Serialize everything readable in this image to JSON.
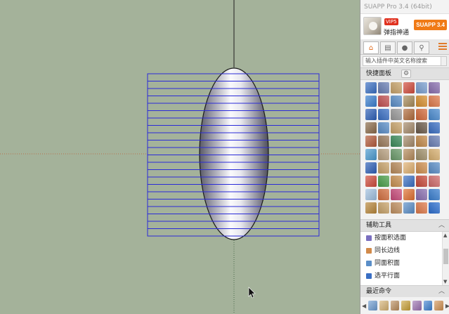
{
  "app": {
    "title": "SUAPP Pro 3.4 (64bit)",
    "brand_badge": "SUAPP 3.4"
  },
  "user": {
    "vip_badge": "VIP5",
    "name": "弹指神通"
  },
  "tabs": [
    {
      "name": "home",
      "icon": "home-icon"
    },
    {
      "name": "chart",
      "icon": "chart-icon"
    },
    {
      "name": "user",
      "icon": "user-icon"
    },
    {
      "name": "search",
      "icon": "search-icon"
    }
  ],
  "search": {
    "placeholder": "输入插件中英文名称搜索"
  },
  "quick_panel": {
    "title": "快捷面板",
    "tool_colors": [
      "#3a6fc4",
      "#6a7fb5",
      "#c8a36a",
      "#d24c3c",
      "#7a9fd0",
      "#8a6fb0",
      "#3a7fd0",
      "#c35050",
      "#5a8ec8",
      "#a78b5a",
      "#d89030",
      "#e07a4a",
      "#2d5fb8",
      "#3a6fc4",
      "#999999",
      "#b06a3a",
      "#d46a3a",
      "#4a8bd0",
      "#8a6a4a",
      "#5a8ec8",
      "#c8a36a",
      "#a58a6a",
      "#6a5a4a",
      "#3a6fc4",
      "#b45a3a",
      "#9a7a5a",
      "#3a8a5a",
      "#a58a6a",
      "#c38a4a",
      "#6a7fb5",
      "#4a9ad0",
      "#b8a080",
      "#6a9a6a",
      "#b48a5a",
      "#a0906a",
      "#d8b070",
      "#2d5fb8",
      "#c8a36a",
      "#b88a5a",
      "#e0b070",
      "#d09050",
      "#5a8ec8",
      "#d04a3a",
      "#4aa04a",
      "#c89050",
      "#3a6fc4",
      "#c84a3a",
      "#d06a6a",
      "#a0c0e0",
      "#d47040",
      "#c84a7a",
      "#e07030",
      "#8a6fb0",
      "#3a7fd0",
      "#b8863a",
      "#c8a36a",
      "#c09060",
      "#5a8ec8",
      "#e07a4a",
      "#2d6fd0"
    ]
  },
  "helper": {
    "title": "辅助工具",
    "items": [
      {
        "label": "按面积选面",
        "color": "#7a6fc0"
      },
      {
        "label": "同长边线",
        "color": "#d28a4a"
      },
      {
        "label": "同面积面",
        "color": "#5a8ec8"
      },
      {
        "label": "选平行面",
        "color": "#3a6fc4"
      }
    ]
  },
  "recent": {
    "title": "最近命令",
    "colors": [
      "#6a9ad0",
      "#d4b070",
      "#b88a5a",
      "#c8a036",
      "#9a6fb0",
      "#3a7fd0",
      "#d09050"
    ]
  }
}
